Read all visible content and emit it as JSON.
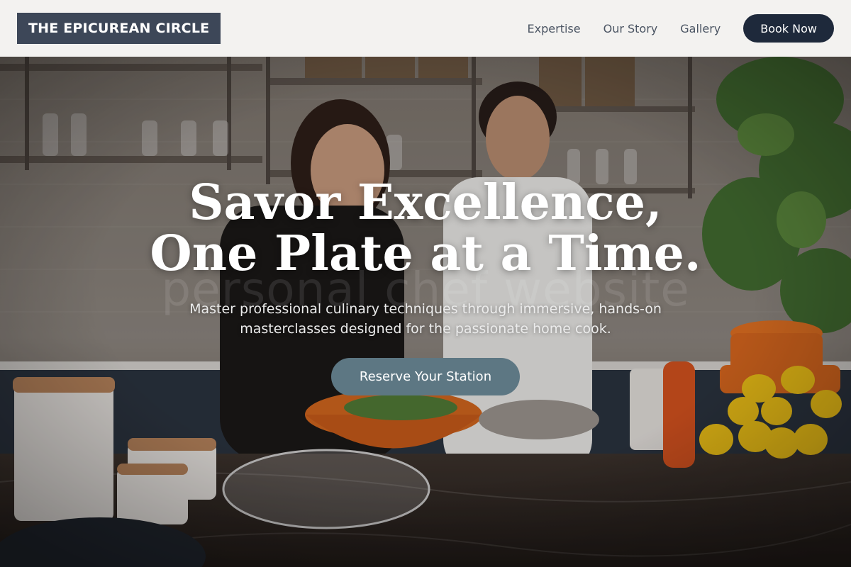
{
  "header": {
    "logo_text": "THE EPICUREAN CIRCLE",
    "nav": [
      {
        "label": "Expertise"
      },
      {
        "label": "Our Story"
      },
      {
        "label": "Gallery"
      }
    ],
    "book_label": "Book Now"
  },
  "hero": {
    "title_line1": "Savor Excellence,",
    "title_line2": "One Plate at a Time.",
    "watermark": "personal chef website",
    "subtitle_line1": "Master professional culinary techniques through immersive, hands-on",
    "subtitle_line2": "masterclasses designed for the passionate home cook.",
    "cta_label": "Reserve Your Station",
    "background_description_icon": "kitchen-photo"
  },
  "colors": {
    "logo_bg": "#3d4758",
    "book_btn_bg": "#1e293b",
    "cta_bg": "#5d7783",
    "header_bg": "#f3f2f0"
  }
}
